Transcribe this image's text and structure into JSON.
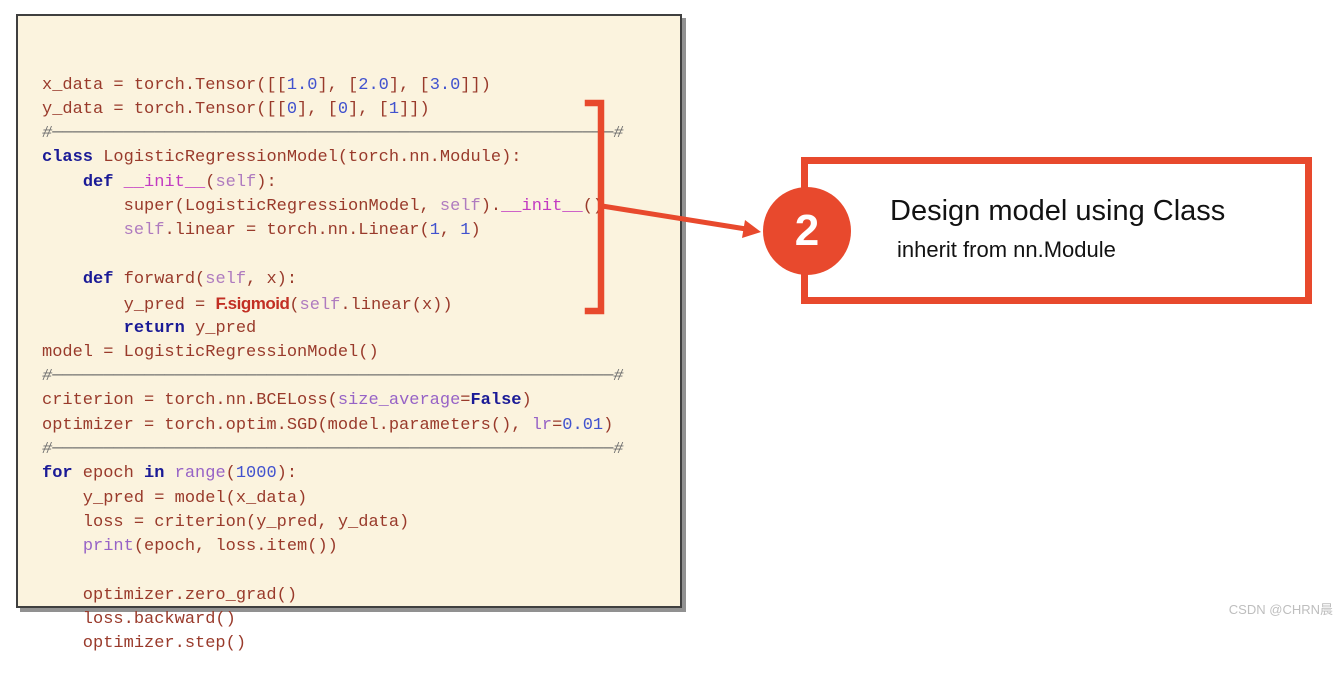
{
  "colors": {
    "accent": "#E8492D",
    "code_background": "#FBF3DE",
    "code_plain": "#993A2B",
    "code_keyword": "#1A1A96",
    "code_number": "#4152CE",
    "code_builtin": "#9763C6",
    "code_self": "#AF7BBF",
    "code_dunder": "#C23AC2",
    "code_comment": "#6E6E6E",
    "highlight_function": "#C22F24"
  },
  "annotation": {
    "step_number": "2",
    "title": "Design model using Class",
    "subtitle": "inherit from nn.Module"
  },
  "watermark": "CSDN @CHRN晨",
  "code_panel": {
    "lines": [
      {
        "segments": [
          [
            "plain",
            "x_data = torch.Tensor([["
          ],
          [
            "num",
            "1.0"
          ],
          [
            "plain",
            "], ["
          ],
          [
            "num",
            "2.0"
          ],
          [
            "plain",
            "], ["
          ],
          [
            "num",
            "3.0"
          ],
          [
            "plain",
            "]])"
          ]
        ]
      },
      {
        "segments": [
          [
            "plain",
            "y_data = torch.Tensor([["
          ],
          [
            "num",
            "0"
          ],
          [
            "plain",
            "], ["
          ],
          [
            "num",
            "0"
          ],
          [
            "plain",
            "], ["
          ],
          [
            "num",
            "1"
          ],
          [
            "plain",
            "]])"
          ]
        ]
      },
      {
        "segments": [
          [
            "comment",
            "#───────────────────────────────────────────────────────#"
          ]
        ]
      },
      {
        "segments": [
          [
            "kw",
            "class"
          ],
          [
            "plain",
            " LogisticRegressionModel(torch.nn.Module):"
          ]
        ]
      },
      {
        "segments": [
          [
            "plain",
            "    "
          ],
          [
            "kw",
            "def"
          ],
          [
            "plain",
            " "
          ],
          [
            "dunder",
            "__init__"
          ],
          [
            "plain",
            "("
          ],
          [
            "self",
            "self"
          ],
          [
            "plain",
            "):"
          ]
        ]
      },
      {
        "segments": [
          [
            "plain",
            "        super(LogisticRegressionModel, "
          ],
          [
            "self",
            "self"
          ],
          [
            "plain",
            ")."
          ],
          [
            "dunder",
            "__init__"
          ],
          [
            "plain",
            "()"
          ]
        ]
      },
      {
        "segments": [
          [
            "plain",
            "        "
          ],
          [
            "self",
            "self"
          ],
          [
            "plain",
            ".linear = torch.nn.Linear("
          ],
          [
            "num",
            "1"
          ],
          [
            "plain",
            ", "
          ],
          [
            "num",
            "1"
          ],
          [
            "plain",
            ")"
          ]
        ]
      },
      {
        "segments": []
      },
      {
        "segments": [
          [
            "plain",
            "    "
          ],
          [
            "kw",
            "def"
          ],
          [
            "plain",
            " forward("
          ],
          [
            "self",
            "self"
          ],
          [
            "plain",
            ", x):"
          ]
        ]
      },
      {
        "segments": [
          [
            "plain",
            "        y_pred = "
          ],
          [
            "fsig",
            "F.sigmoid"
          ],
          [
            "plain",
            "("
          ],
          [
            "self",
            "self"
          ],
          [
            "plain",
            ".linear(x))"
          ]
        ]
      },
      {
        "segments": [
          [
            "plain",
            "        "
          ],
          [
            "kw",
            "return"
          ],
          [
            "plain",
            " y_pred"
          ]
        ]
      },
      {
        "segments": [
          [
            "plain",
            "model = LogisticRegressionModel()"
          ]
        ]
      },
      {
        "segments": [
          [
            "comment",
            "#───────────────────────────────────────────────────────#"
          ]
        ]
      },
      {
        "segments": [
          [
            "plain",
            "criterion = torch.nn.BCELoss("
          ],
          [
            "builtin",
            "size_average"
          ],
          [
            "plain",
            "="
          ],
          [
            "kw",
            "False"
          ],
          [
            "plain",
            ")"
          ]
        ]
      },
      {
        "segments": [
          [
            "plain",
            "optimizer = torch.optim.SGD(model.parameters(), "
          ],
          [
            "builtin",
            "lr"
          ],
          [
            "plain",
            "="
          ],
          [
            "num",
            "0.01"
          ],
          [
            "plain",
            ")"
          ]
        ]
      },
      {
        "segments": [
          [
            "comment",
            "#───────────────────────────────────────────────────────#"
          ]
        ]
      },
      {
        "segments": [
          [
            "kw",
            "for"
          ],
          [
            "plain",
            " epoch "
          ],
          [
            "kw",
            "in"
          ],
          [
            "plain",
            " "
          ],
          [
            "builtin",
            "range"
          ],
          [
            "plain",
            "("
          ],
          [
            "num",
            "1000"
          ],
          [
            "plain",
            "):"
          ]
        ]
      },
      {
        "segments": [
          [
            "plain",
            "    y_pred = model(x_data)"
          ]
        ]
      },
      {
        "segments": [
          [
            "plain",
            "    loss = criterion(y_pred, y_data)"
          ]
        ]
      },
      {
        "segments": [
          [
            "plain",
            "    "
          ],
          [
            "builtin",
            "print"
          ],
          [
            "plain",
            "(epoch, loss.item())"
          ]
        ]
      },
      {
        "segments": []
      },
      {
        "segments": [
          [
            "plain",
            "    optimizer.zero_grad()"
          ]
        ]
      },
      {
        "segments": [
          [
            "plain",
            "    loss.backward()"
          ]
        ]
      },
      {
        "segments": [
          [
            "plain",
            "    optimizer.step()"
          ]
        ]
      }
    ]
  }
}
